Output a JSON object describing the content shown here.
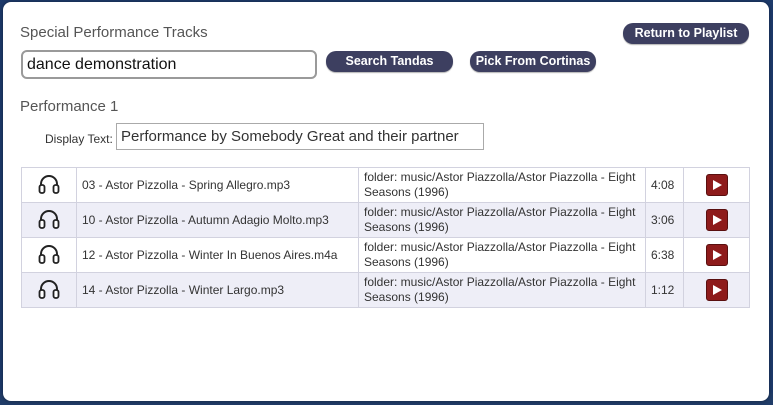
{
  "header": {
    "title": "Special Performance Tracks",
    "return_label": "Return to Playlist"
  },
  "search": {
    "value": "dance demonstration",
    "search_tandas_label": "Search Tandas",
    "pick_cortinas_label": "Pick From Cortinas"
  },
  "performance": {
    "title": "Performance 1",
    "display_label": "Display Text:",
    "display_value": "Performance by Somebody Great and their partner"
  },
  "tracks": [
    {
      "file": "03 - Astor Pizzolla - Spring Allegro.mp3",
      "folder": "folder: music/Astor Piazzolla/Astor Piazzolla - Eight Seasons (1996)",
      "duration": "4:08"
    },
    {
      "file": "10 - Astor Pizzolla - Autumn Adagio Molto.mp3",
      "folder": "folder: music/Astor Piazzolla/Astor Piazzolla - Eight Seasons (1996)",
      "duration": "3:06"
    },
    {
      "file": "12 - Astor Pizzolla - Winter In Buenos Aires.m4a",
      "folder": "folder: music/Astor Piazzolla/Astor Piazzolla - Eight Seasons (1996)",
      "duration": "6:38"
    },
    {
      "file": "14 - Astor Pizzolla - Winter Largo.mp3",
      "folder": "folder: music/Astor Piazzolla/Astor Piazzolla - Eight Seasons (1996)",
      "duration": "1:12"
    }
  ],
  "icons": {
    "row_icon": "headphones-icon",
    "action_icon": "play-icon"
  },
  "colors": {
    "button_bg": "#3d3f60",
    "play_bg": "#8e1b1b",
    "alt_row": "#eeeef7"
  }
}
